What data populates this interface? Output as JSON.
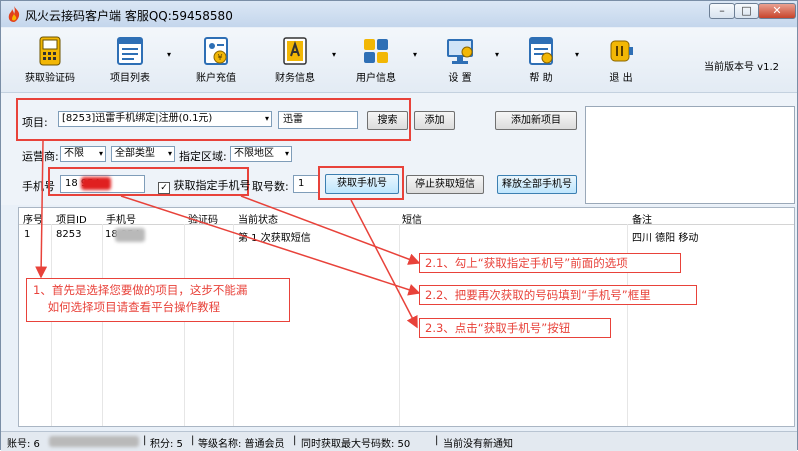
{
  "window": {
    "title": "风火云接码客户端  客服QQ:59458580",
    "controls": [
      "minimize-icon",
      "maximize-icon",
      "close-icon"
    ],
    "control_glyphs": [
      "–",
      "□",
      "✕"
    ]
  },
  "toolbar": {
    "items": [
      {
        "label": "获取验证码",
        "icon": "sim-card-icon"
      },
      {
        "label": "项目列表",
        "icon": "list-icon"
      },
      {
        "label": "账户充值",
        "icon": "recharge-icon"
      },
      {
        "label": "财务信息",
        "icon": "finance-icon"
      },
      {
        "label": "用户信息",
        "icon": "user-info-icon"
      },
      {
        "label": "设 置",
        "icon": "settings-monitor-icon"
      },
      {
        "label": "帮 助",
        "icon": "help-icon"
      },
      {
        "label": "退 出",
        "icon": "exit-icon"
      }
    ],
    "dropdown_glyph": "▾",
    "version": "当前版本号 v1.2"
  },
  "form": {
    "project_label": "项目:",
    "project_value": "[8253]迅雷手机绑定|注册(0.1元)",
    "search_value": "迅雷",
    "search_button": "搜索",
    "add_button": "添加",
    "add_new_project_button": "添加新项目",
    "carrier_label": "运营商:",
    "carrier_value": "不限",
    "type_value": "全部类型",
    "region_label": "指定区域:",
    "region_value": "不限地区",
    "phone_label": "手机号",
    "phone_value": "18        954",
    "specify_phone_checkbox": "获取指定手机号",
    "specify_phone_checked": true,
    "count_label": "取号数:",
    "count_value": "1",
    "get_phone_button": "获取手机号",
    "stop_sms_button": "停止获取短信",
    "release_all_button": "释放全部手机号"
  },
  "grid": {
    "columns": [
      "序号",
      "项目ID",
      "手机号",
      "验证码",
      "当前状态",
      "短信",
      "备注"
    ],
    "rows": [
      {
        "index": "1",
        "project_id": "8253",
        "phone": "18        954",
        "code": "",
        "status": "第 1 次获取短信",
        "sms": "",
        "note": "四川 德阳 移动"
      }
    ]
  },
  "callouts": {
    "step1": "1、首先是选择您要做的项目，这步不能漏\n    如何选择项目请查看平台操作教程",
    "step21": "2.1、勾上“获取指定手机号”前面的选项",
    "step22": "2.2、把要再次获取的号码填到“手机号”框里",
    "step23": "2.3、点击“获取手机号”按钮"
  },
  "statusbar": {
    "account": "账号: 6",
    "points": "积分: 5",
    "level": "等级名称: 普通会员",
    "max_count": "同时获取最大号码数: 50",
    "notice": "当前没有新通知",
    "separator": "|"
  },
  "colors": {
    "annotation_red": "#e8423a",
    "toolbar_icon_blue": "#2e6fb5",
    "toolbar_icon_yellow": "#f2b705"
  }
}
